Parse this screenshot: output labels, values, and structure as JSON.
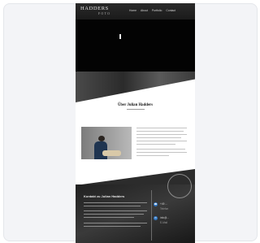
{
  "header": {
    "logo_main": "HADDERS",
    "logo_sub": "FOTO",
    "nav_items": [
      "Home",
      "About",
      "Portfolio",
      "Contact"
    ]
  },
  "about": {
    "title": "Über Julian Hadders"
  },
  "contact": {
    "title": "Kontakt zu Julian Hadders",
    "items": [
      {
        "icon": "phone-icon",
        "line1": "+49 ...",
        "line2": "Telefon"
      },
      {
        "icon": "mail-icon",
        "line1": "info@...",
        "line2": "E-Mail"
      }
    ]
  },
  "colors": {
    "dark_bg": "#030303",
    "contact_bg": "#2a2a2a",
    "accent_blue": "#2f76c4"
  }
}
